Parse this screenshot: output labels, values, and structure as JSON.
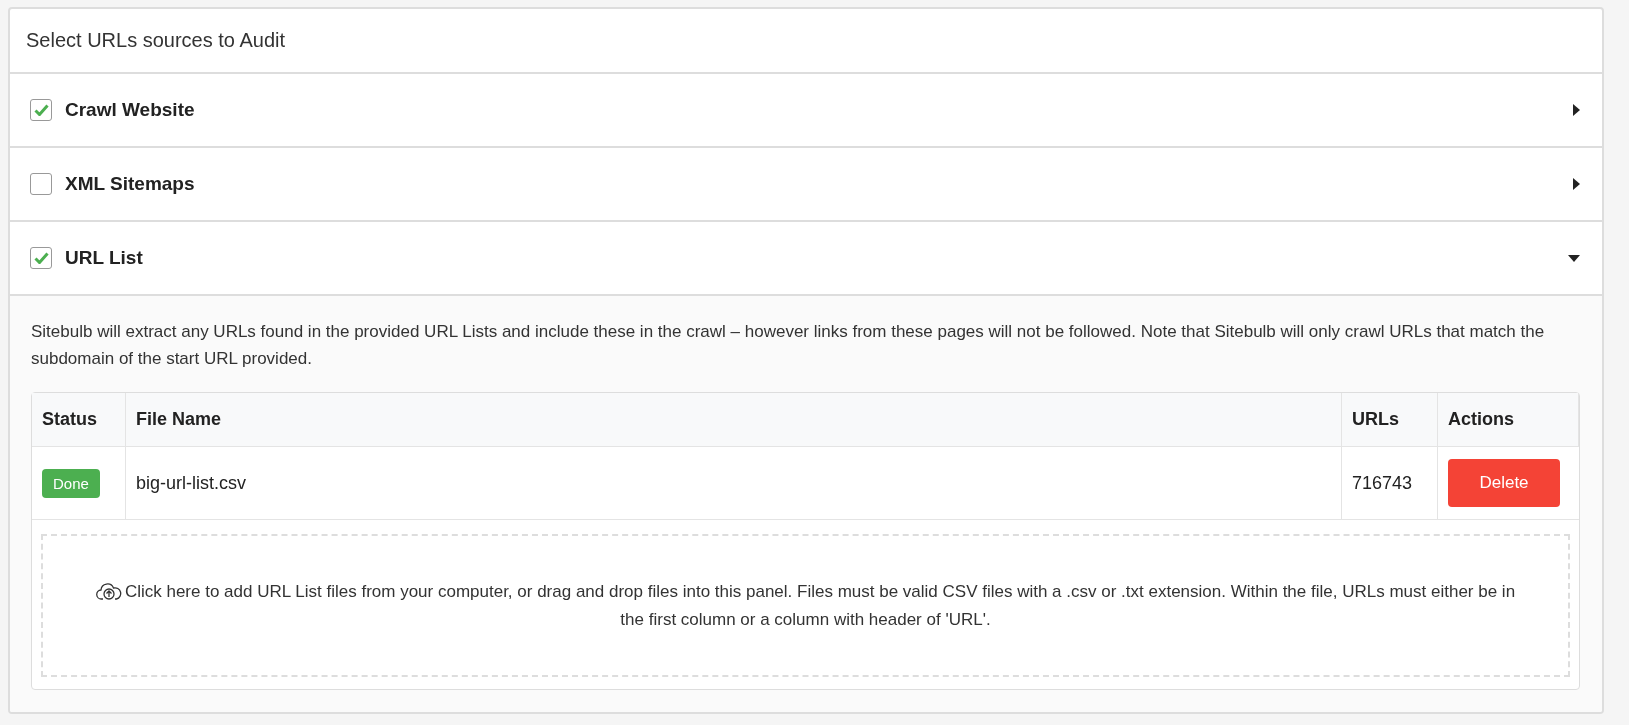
{
  "panel": {
    "title": "Select URLs sources to Audit"
  },
  "sources": [
    {
      "label": "Crawl Website",
      "checked": true,
      "expanded": false
    },
    {
      "label": "XML Sitemaps",
      "checked": false,
      "expanded": false
    },
    {
      "label": "URL List",
      "checked": true,
      "expanded": true
    }
  ],
  "url_list": {
    "description": "Sitebulb will extract any URLs found in the provided URL Lists and include these in the crawl – however links from these pages will not be followed. Note that Sitebulb will only crawl URLs that match the subdomain of the start URL provided.",
    "table": {
      "columns": [
        "Status",
        "File Name",
        "URLs",
        "Actions"
      ],
      "rows": [
        {
          "status": "Done",
          "file_name": "big-url-list.csv",
          "urls": "716743",
          "action": "Delete"
        }
      ]
    },
    "dropzone": {
      "text": "Click here to add URL List files from your computer, or drag and drop files into this panel. Files must be valid CSV files with a .csv or .txt extension. Within the file, URLs must either be in the first column or a column with header of 'URL'."
    }
  }
}
